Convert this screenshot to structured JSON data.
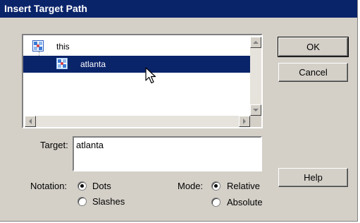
{
  "window": {
    "title": "Insert Target Path"
  },
  "tree": {
    "items": [
      {
        "label": "this",
        "icon": "movieclip-icon",
        "selected": false
      },
      {
        "label": "atlanta",
        "icon": "movieclip-icon",
        "selected": true
      }
    ]
  },
  "buttons": {
    "ok": "OK",
    "cancel": "Cancel",
    "help": "Help"
  },
  "target": {
    "label": "Target:",
    "value": "atlanta"
  },
  "notation": {
    "label": "Notation:",
    "options": [
      "Dots",
      "Slashes"
    ],
    "selected": "Dots"
  },
  "mode": {
    "label": "Mode:",
    "options": [
      "Relative",
      "Absolute"
    ],
    "selected": "Relative"
  },
  "colors": {
    "titlebar": "#0a246a",
    "face": "#d4d0c8",
    "selection": "#0a246a"
  }
}
